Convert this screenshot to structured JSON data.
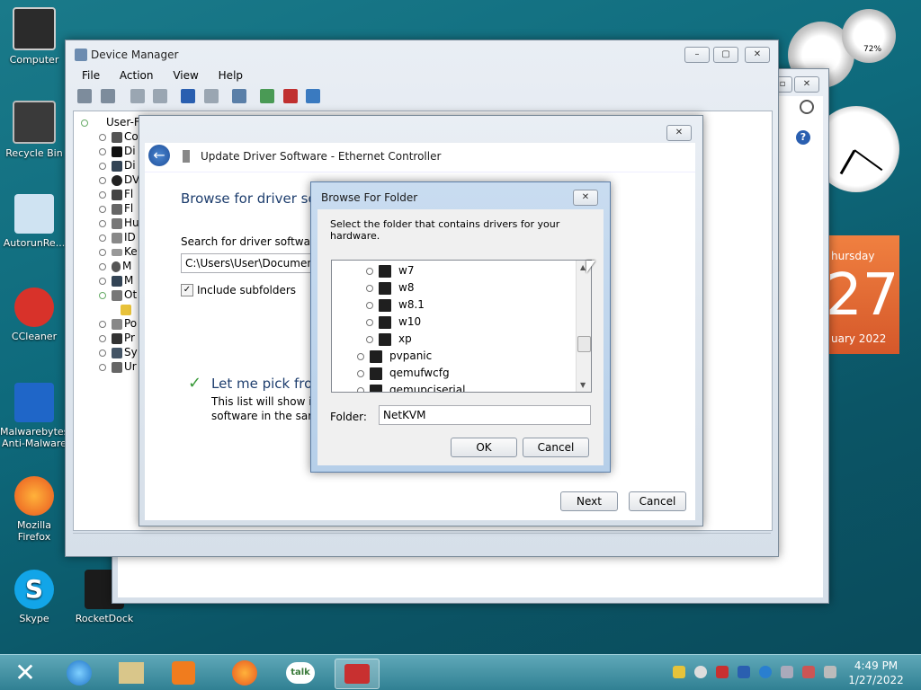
{
  "desktop": {
    "icons": [
      {
        "label": "Computer"
      },
      {
        "label": "Recycle Bin"
      },
      {
        "label": "AutorunRe..."
      },
      {
        "label": "CCleaner"
      },
      {
        "label": "Malwarebytes Anti-Malware"
      },
      {
        "label": "Mozilla Firefox"
      },
      {
        "label": "Skype"
      },
      {
        "label": "RocketDock"
      }
    ]
  },
  "gadgets": {
    "meter_percent": "72%",
    "calendar_day": "27",
    "calendar_weekday": "hursday",
    "calendar_month": "uary 2022"
  },
  "device_manager": {
    "title": "Device Manager",
    "menu": [
      "File",
      "Action",
      "View",
      "Help"
    ],
    "tree_root": "User-F",
    "tree_items": [
      "Co",
      "Di",
      "Di",
      "DV",
      "Fl",
      "Fl",
      "Hu",
      "ID",
      "Ke",
      "M",
      "M",
      "Ot",
      "",
      "Po",
      "Pr",
      "Sy",
      "Ur"
    ]
  },
  "update_driver": {
    "title": "Update Driver Software - Ethernet Controller",
    "heading": "Browse for driver sof",
    "search_label": "Search for driver software in",
    "path_value": "C:\\Users\\User\\Documents",
    "include_subfolders": "Include subfolders",
    "pick_title": "Let me pick from",
    "pick_desc_1": "This list will show inst",
    "pick_desc_2": "software in the same",
    "next": "Next",
    "cancel": "Cancel"
  },
  "browse_folder": {
    "title": "Browse For Folder",
    "instruction": "Select the folder that contains drivers for your hardware.",
    "tree": [
      {
        "label": "w7",
        "level": 2
      },
      {
        "label": "w8",
        "level": 2
      },
      {
        "label": "w8.1",
        "level": 2
      },
      {
        "label": "w10",
        "level": 2
      },
      {
        "label": "xp",
        "level": 2
      },
      {
        "label": "pvpanic",
        "level": 1
      },
      {
        "label": "qemufwcfg",
        "level": 1
      },
      {
        "label": "qemupciserial",
        "level": 1
      }
    ],
    "folder_label": "Folder:",
    "folder_value": "NetKVM",
    "ok": "OK",
    "cancel": "Cancel"
  },
  "taskbar": {
    "time": "4:49 PM",
    "date": "1/27/2022"
  }
}
